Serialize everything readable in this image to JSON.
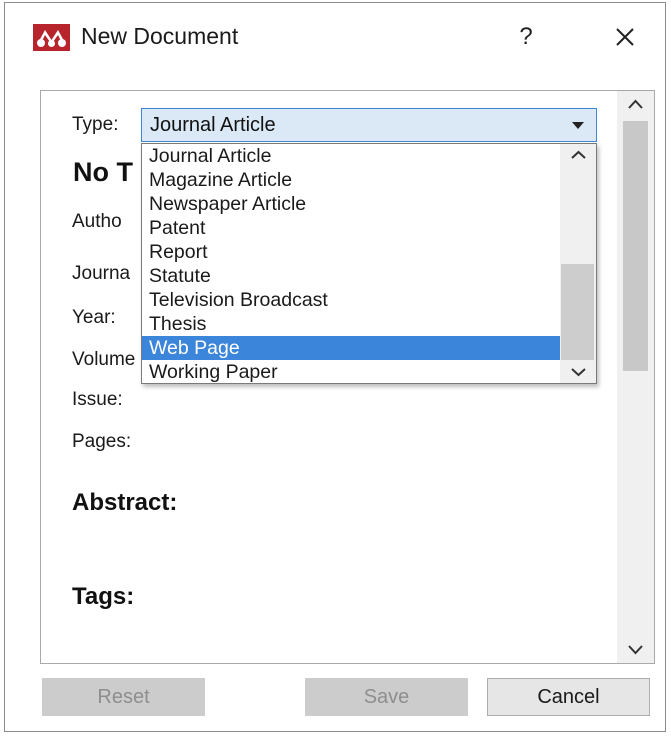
{
  "window": {
    "title": "New Document",
    "help_label": "?"
  },
  "form": {
    "type_label": "Type:",
    "type_value": "Journal Article",
    "doc_title": "No T",
    "author_label": "Autho",
    "journal_label": "Journa",
    "year_label": "Year:",
    "volume_label": "Volume",
    "issue_label": "Issue:",
    "pages_label": "Pages:",
    "abstract_heading": "Abstract:",
    "tags_heading": "Tags:"
  },
  "dropdown": {
    "items": [
      {
        "label": "Journal Article"
      },
      {
        "label": "Magazine Article"
      },
      {
        "label": "Newspaper Article"
      },
      {
        "label": "Patent"
      },
      {
        "label": "Report"
      },
      {
        "label": "Statute"
      },
      {
        "label": "Television Broadcast"
      },
      {
        "label": "Thesis"
      },
      {
        "label": "Web Page"
      },
      {
        "label": "Working Paper"
      }
    ],
    "selected": "Web Page"
  },
  "buttons": {
    "reset": "Reset",
    "save": "Save",
    "cancel": "Cancel"
  },
  "colors": {
    "accent": "#3b85db",
    "app_icon": "#b8242b",
    "select_bg": "#dbe9f7"
  },
  "icons": [
    "mendeley-logo-icon",
    "close-icon",
    "scroll-up-icon",
    "scroll-down-icon",
    "dropdown-caret-icon"
  ]
}
